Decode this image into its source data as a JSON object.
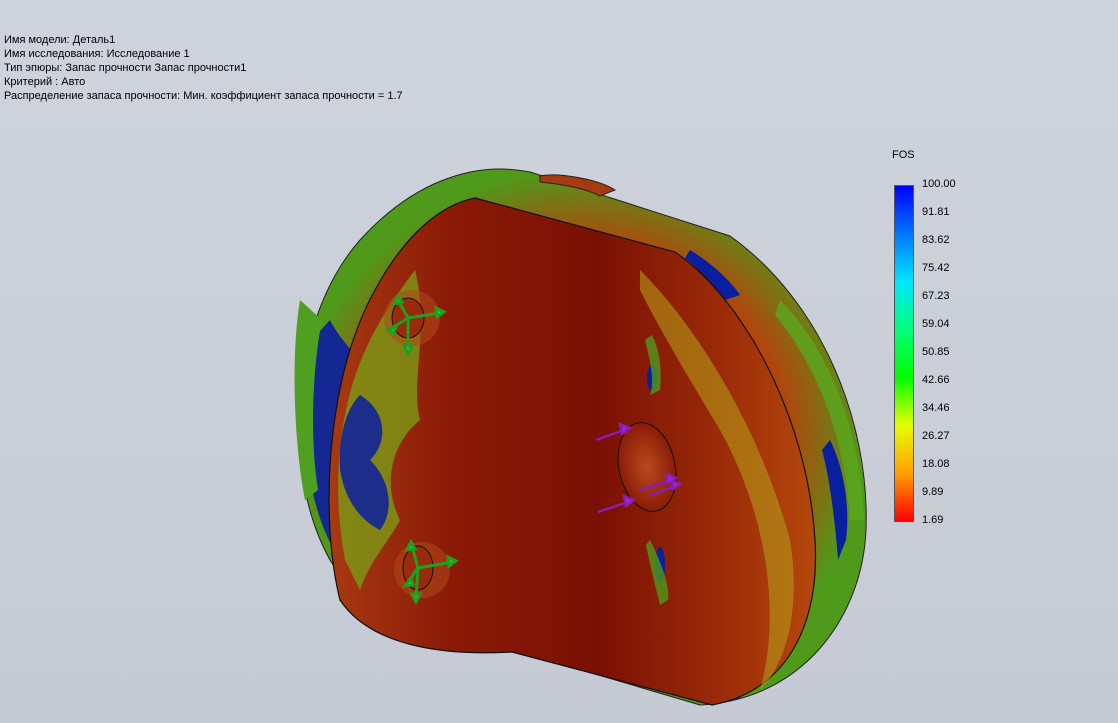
{
  "info": {
    "model_name": "Имя модели: Деталь1",
    "study_name": "Имя  исследования: Исследование 1",
    "plot_type": "Тип эпюры: Запас прочности Запас прочности1",
    "criterion": "Критерий : Авто",
    "distribution": "Распределение запаса прочности: Мин. коэффициент запаса прочности = 1.7"
  },
  "legend": {
    "title": "FOS",
    "ticks": [
      "100.00",
      "91.81",
      "83.62",
      "75.42",
      "67.23",
      "59.04",
      "50.85",
      "42.66",
      "34.46",
      "26.27",
      "18.08",
      "9.89",
      "1.69"
    ],
    "colors": [
      "#0000ff",
      "#0078ff",
      "#00e6ff",
      "#00ff78",
      "#00ff00",
      "#e6ff00",
      "#ffa000",
      "#ff0000"
    ]
  },
  "icons": {
    "fixture": "fixture-arrows-icon",
    "load": "force-arrows-icon"
  }
}
